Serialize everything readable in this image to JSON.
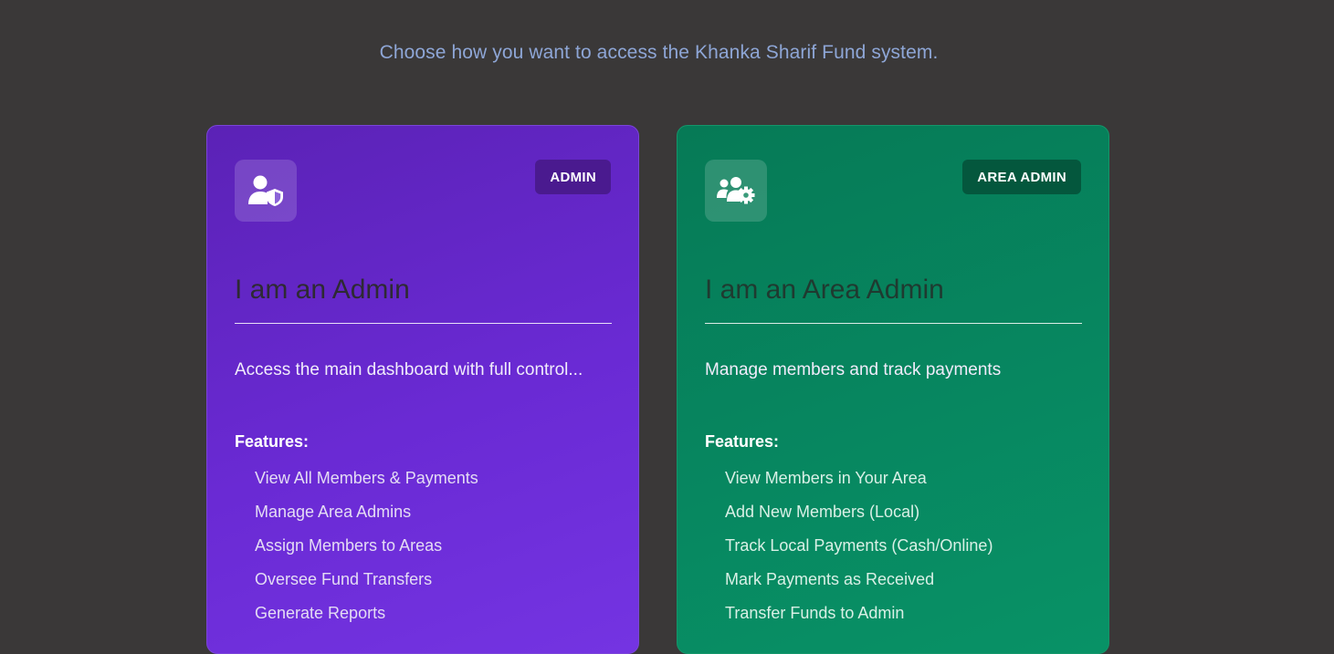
{
  "page": {
    "subtitle": "Choose how you want to access the Khanka Sharif Fund system."
  },
  "cards": [
    {
      "badge": "ADMIN",
      "icon": "user-shield-icon",
      "title": "I am an Admin",
      "description": "Access the main dashboard with full control...",
      "features_heading": "Features:",
      "features": [
        "View All Members & Payments",
        "Manage Area Admins",
        "Assign Members to Areas",
        "Oversee Fund Transfers",
        "Generate Reports"
      ],
      "accent": "#6a2ad4"
    },
    {
      "badge": "AREA ADMIN",
      "icon": "users-gear-icon",
      "title": "I am an Area Admin",
      "description": "Manage members and track payments",
      "features_heading": "Features:",
      "features": [
        "View Members in Your Area",
        "Add New Members (Local)",
        "Track Local Payments (Cash/Online)",
        "Mark Payments as Received",
        "Transfer Funds to Admin"
      ],
      "accent": "#078760"
    }
  ]
}
